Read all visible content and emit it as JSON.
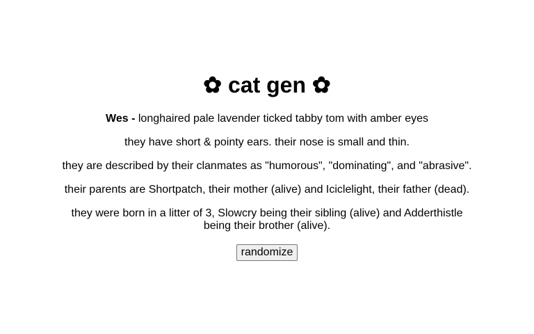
{
  "title": "✿ cat gen ✿",
  "cat": {
    "name": "Wes -",
    "description": "longhaired pale lavender ticked tabby tom with amber eyes",
    "appearance": "they have short & pointy ears. their nose is small and thin.",
    "personality": "they are described by their clanmates as \"humorous\", \"dominating\", and \"abrasive\".",
    "parents": "their parents are Shortpatch, their mother (alive) and Iciclelight, their father (dead).",
    "litter": "they were born in a litter of 3, Slowcry being their sibling (alive) and Adderthistle being their brother (alive)."
  },
  "randomize_label": "randomize"
}
